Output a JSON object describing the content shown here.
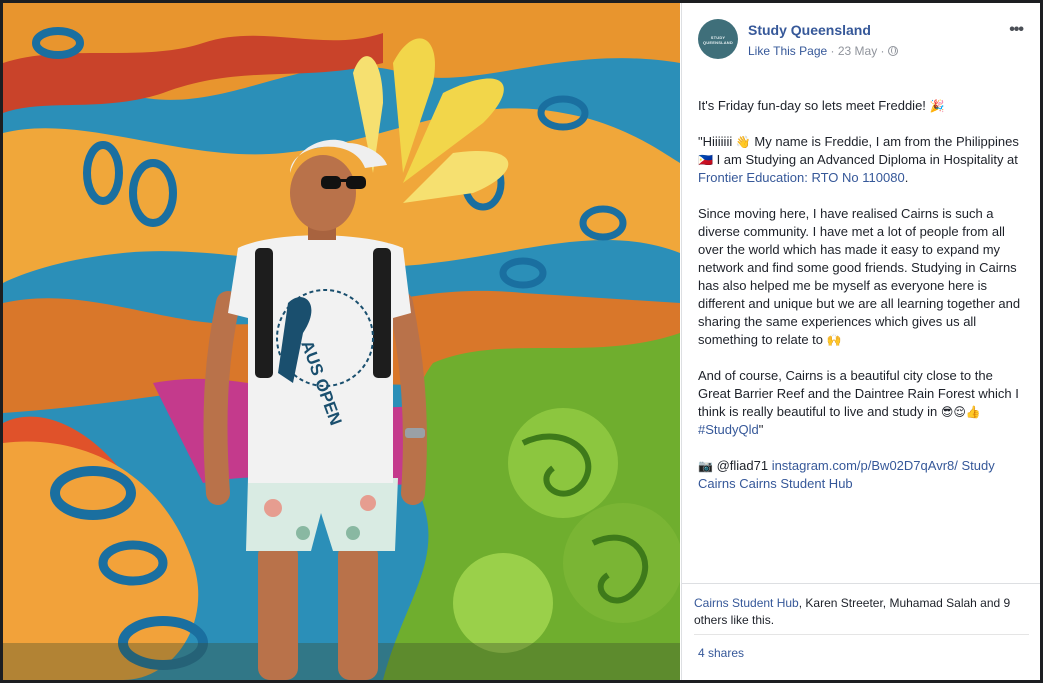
{
  "post": {
    "page_name": "Study Queensland",
    "avatar_text": "STUDY QUEENSLAND",
    "like_label": "Like This Page",
    "date": "23 May",
    "dot_separator": " · ",
    "more_icon": "more-options-icon",
    "privacy_icon": "globe-icon",
    "paragraphs": {
      "p1_text": "It's Friday fun-day so lets meet Freddie! ",
      "p1_emoji": "🎉",
      "p2_a": "\"Hiiiiiii ",
      "p2_wave": "👋",
      "p2_b": " My name is Freddie, I am from the Philippines ",
      "p2_flag": "🇵🇭",
      "p2_c": " I am Studying an Advanced Diploma in Hospitality at ",
      "p2_link": "Frontier Education: RTO No 110080",
      "p2_end": ".",
      "p3": "Since moving here, I have realised Cairns is such a diverse community. I have met a lot of people from all over the world which has made it easy to expand my network and find some good friends. Studying in Cairns has also helped me be myself as everyone here is different and unique but we are all learning together and sharing the same experiences which gives us all something to relate to ",
      "p3_emoji": "🙌",
      "p4_a": "And of course, Cairns is a beautiful city close to the Great Barrier Reef and the Daintree Rain Forest which I think is really beautiful to live and study in ",
      "p4_emojis": "😎😌👍",
      "p4_hashtag": "#StudyQld",
      "p4_end": "\"",
      "p5_camera": "📷",
      "p5_handle": " @fliad71 ",
      "p5_link1": "instagram.com/p/Bw02D7qAvr8/",
      "p5_link2": "Study Cairns",
      "p5_link3": "Cairns Student Hub"
    }
  },
  "reactions": {
    "first_liker": "Cairns Student Hub",
    "rest": ", Karen Streeter, Muhamad Salah and 9 others like this."
  },
  "shares": "4 shares",
  "photo": {
    "shirt_text": "AUS OPEN",
    "accent_colors": [
      "#f2a23a",
      "#1a6fa0",
      "#e0522a",
      "#7ec242",
      "#c43a8c"
    ]
  }
}
